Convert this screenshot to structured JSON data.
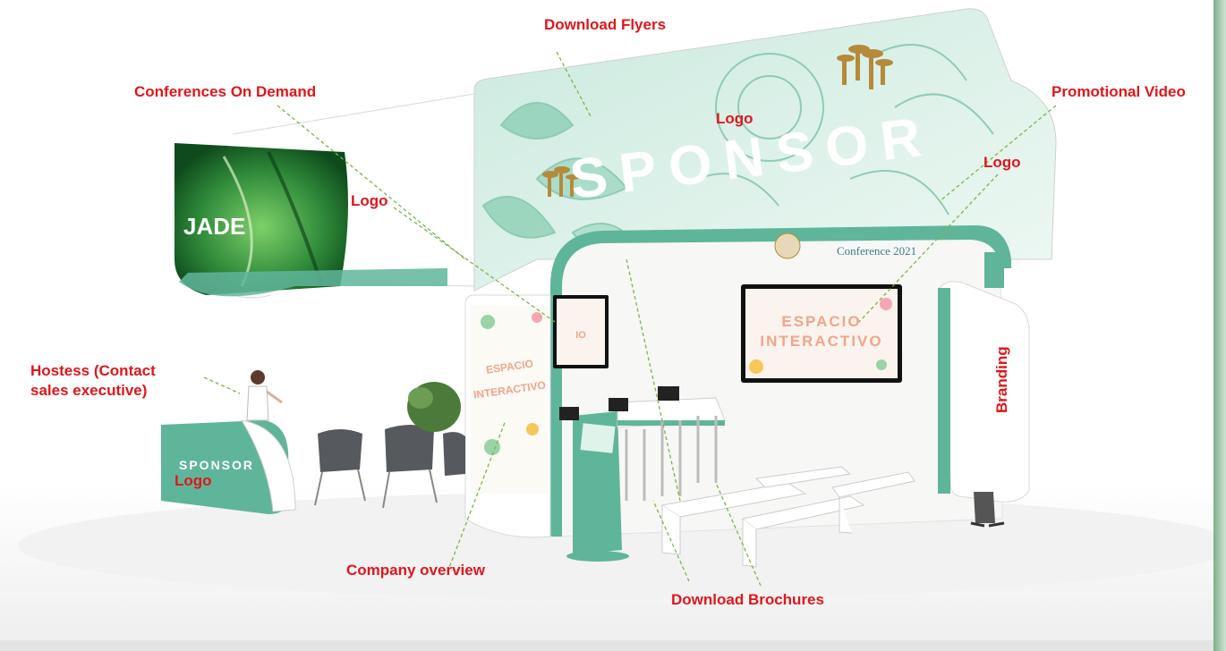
{
  "signage": {
    "main_banner": "SPONSOR",
    "side_banner": "JADE",
    "counter_text": "SPONSOR",
    "screen_text_line1": "ESPACIO",
    "screen_text_line2": "INTERACTIVO",
    "conference_caption": "Conference 2021"
  },
  "labels": {
    "download_flyers": "Download Flyers",
    "conferences_on_demand": "Conferences On Demand",
    "promotional_video": "Promotional Video",
    "logo_top": "Logo",
    "logo_left": "Logo",
    "logo_right": "Logo",
    "logo_counter": "Logo",
    "hostess": "Hostess (Contact sales executive)",
    "branding": "Branding",
    "company_overview": "Company  overview",
    "download_brochures": "Download Brochures"
  },
  "colors": {
    "label_red": "#e0161b",
    "mint": "#5fb59a",
    "mint_light": "#cfeee2",
    "leader_green": "#7ab648"
  }
}
